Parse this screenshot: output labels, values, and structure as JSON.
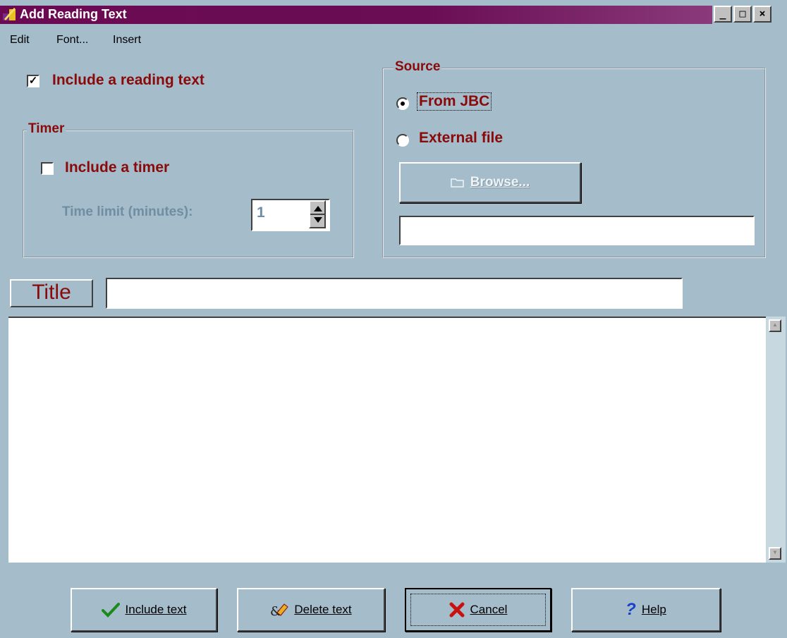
{
  "window": {
    "title": "Add Reading Text",
    "minimize": "_",
    "maximize": "□",
    "close": "×"
  },
  "menu": [
    {
      "label": "Edit"
    },
    {
      "label": "Font..."
    },
    {
      "label": "Insert"
    }
  ],
  "reading": {
    "include_label": "Include a reading text",
    "include_checked": true,
    "check_mark": "✓"
  },
  "timer": {
    "legend": "Timer",
    "include_label": "Include a timer",
    "include_checked": false,
    "time_limit_label": "Time limit (minutes):",
    "time_limit_value": "1"
  },
  "source": {
    "legend": "Source",
    "options": [
      {
        "label": "From JBC",
        "selected": true
      },
      {
        "label": "External file",
        "selected": false
      }
    ],
    "browse_label": "Browse...",
    "file_value": ""
  },
  "title_field": {
    "label": "Title",
    "value": ""
  },
  "buttons": {
    "include": "Include text",
    "delete": "Delete text",
    "cancel": "Cancel",
    "help": "Help"
  },
  "colors": {
    "background": "#a5bccb",
    "title_bar": "#6b0a52",
    "label_red": "#8a0a0a"
  }
}
